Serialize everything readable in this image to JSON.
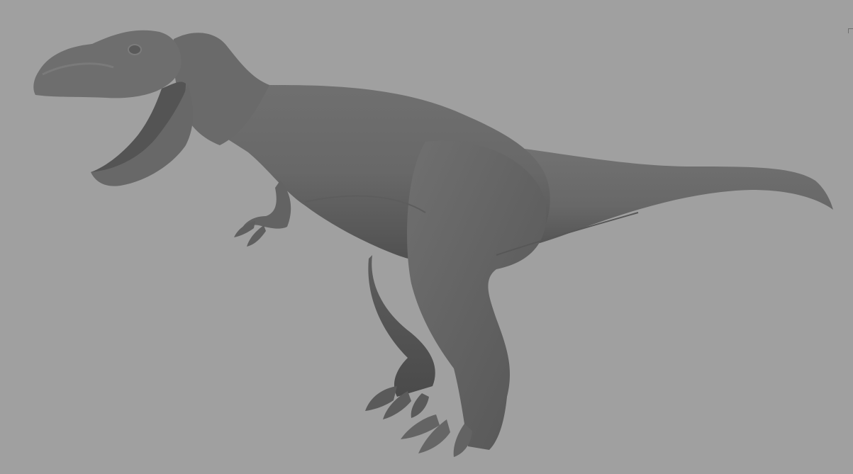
{
  "viewport": {
    "background_color": "#a0a0a0",
    "model_shade": "#6b6b6b",
    "model_shadow": "#4e4e4e",
    "model_highlight": "#808080",
    "subject": "t-rex-sculpt"
  }
}
